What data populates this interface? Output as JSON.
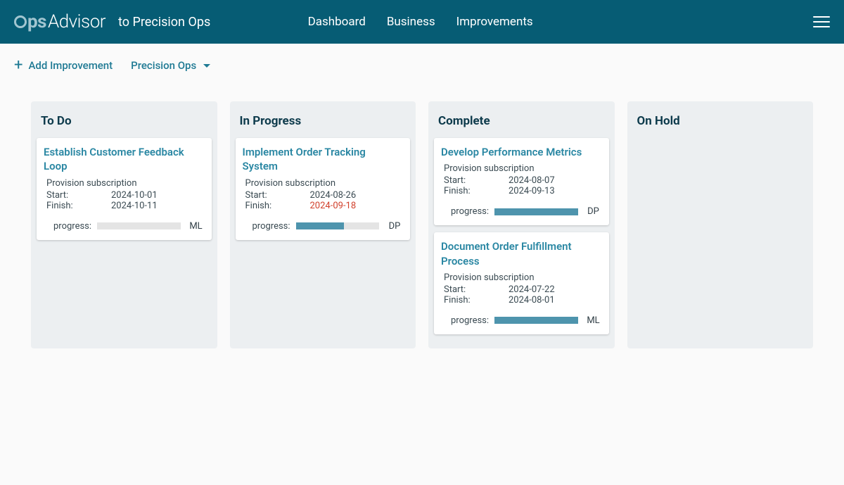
{
  "header": {
    "logo_ops": "ps",
    "logo_advisor": "Advisor",
    "to_label": "to Precision Ops"
  },
  "nav": {
    "dashboard": "Dashboard",
    "business": "Business",
    "improvements": "Improvements"
  },
  "toolbar": {
    "add_label": "Add Improvement",
    "filter_label": "Precision Ops"
  },
  "columns": [
    {
      "title": "To Do"
    },
    {
      "title": "In Progress"
    },
    {
      "title": "Complete"
    },
    {
      "title": "On Hold"
    }
  ],
  "cards": {
    "c0": {
      "title": "Establish Customer Feedback Loop",
      "sub": "Provision subscription",
      "start_lbl": "Start:",
      "start": "2024-10-01",
      "finish_lbl": "Finish:",
      "finish": "2024-10-11",
      "prog_lbl": "progress:",
      "initials": "ML",
      "progress_pct": 0
    },
    "c1": {
      "title": "Implement Order Tracking System",
      "sub": "Provision subscription",
      "start_lbl": "Start:",
      "start": "2024-08-26",
      "finish_lbl": "Finish:",
      "finish": "2024-09-18",
      "prog_lbl": "progress:",
      "initials": "DP",
      "progress_pct": 58
    },
    "c2": {
      "title": "Develop Performance Metrics",
      "sub": "Provision subscription",
      "start_lbl": "Start:",
      "start": "2024-08-07",
      "finish_lbl": "Finish:",
      "finish": "2024-09-13",
      "prog_lbl": "progress:",
      "initials": "DP",
      "progress_pct": 100
    },
    "c3": {
      "title": "Document Order Fulfillment Process",
      "sub": "Provision subscription",
      "start_lbl": "Start:",
      "start": "2024-07-22",
      "finish_lbl": "Finish:",
      "finish": "2024-08-01",
      "prog_lbl": "progress:",
      "initials": "ML",
      "progress_pct": 100
    }
  }
}
